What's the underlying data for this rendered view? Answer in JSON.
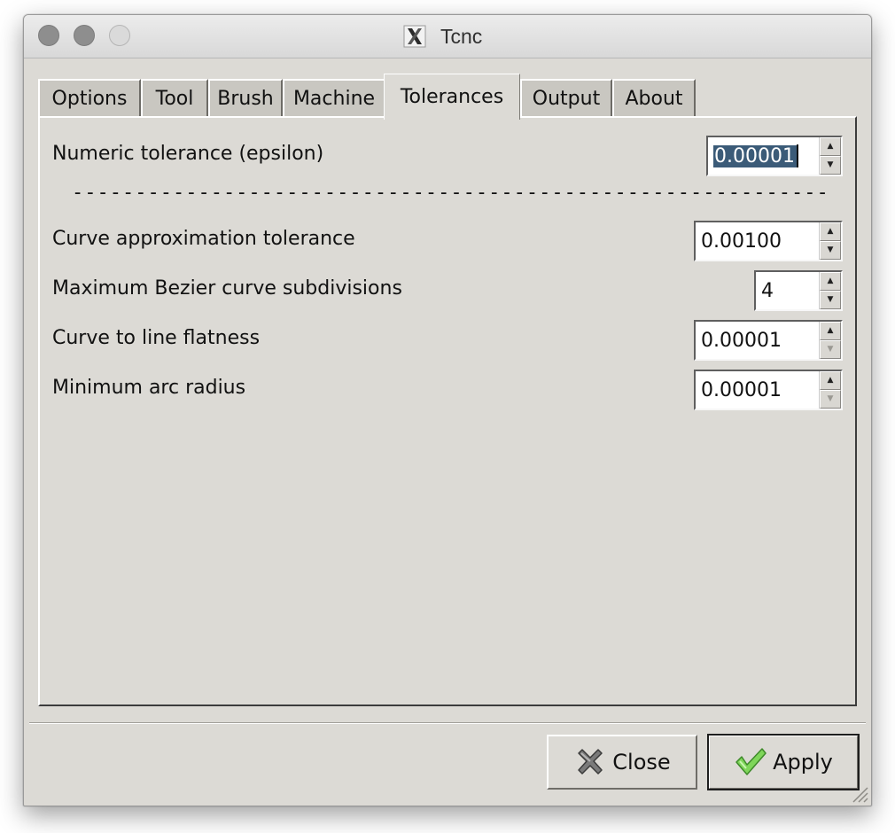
{
  "window": {
    "title": "Tcnc"
  },
  "tabs": [
    {
      "label": "Options",
      "active": false
    },
    {
      "label": "Tool",
      "active": false
    },
    {
      "label": "Brush",
      "active": false
    },
    {
      "label": "Machine",
      "active": false
    },
    {
      "label": "Tolerances",
      "active": true
    },
    {
      "label": "Output",
      "active": false
    },
    {
      "label": "About",
      "active": false
    }
  ],
  "tolerances": {
    "epsilon": {
      "label": "Numeric tolerance (epsilon)",
      "value": "0.00001"
    },
    "separator": "--------------------------------------------------------------------",
    "curve_tolerance": {
      "label": "Curve approximation tolerance",
      "value": "0.00100"
    },
    "bezier_subdivisions": {
      "label": "Maximum Bezier curve subdivisions",
      "value": "4"
    },
    "line_flatness": {
      "label": "Curve to line flatness",
      "value": "0.00001"
    },
    "min_arc_radius": {
      "label": "Minimum arc radius",
      "value": "0.00001"
    }
  },
  "buttons": {
    "close": "Close",
    "apply": "Apply"
  },
  "icons": {
    "title": "x11-icon",
    "close": "close-x-icon",
    "apply": "checkmark-icon",
    "resize": "resize-grip-icon"
  },
  "colors": {
    "window_bg": "#dcdad5",
    "selection": "#3b5b78",
    "checkmark": "#6fcf4a"
  }
}
